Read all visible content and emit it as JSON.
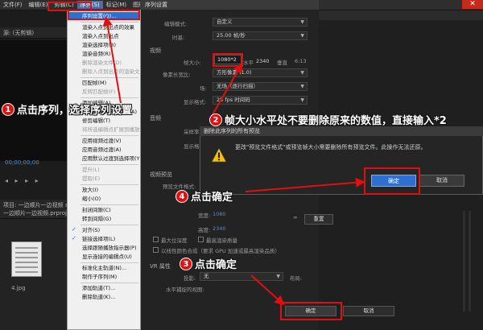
{
  "menubar": {
    "items": [
      "文件(F)",
      "编辑(E)",
      "剪辑(C)",
      "序列(S)",
      "标记(M)",
      "图形(G)",
      "窗口(W)",
      "帮助(H)"
    ],
    "active_index": 3
  },
  "left_panel": {
    "tab_label": "源: (无剪辑)",
    "timecode": "00;00;00;00",
    "project_tabs": "项目: 一边顺片一边视频 ≡",
    "project_tab2": "一边顺片一边视频.prproj",
    "thumb_label": "4.jpg"
  },
  "sequence_menu": {
    "items": [
      {
        "label": "序列设置(Q)...",
        "state": "highlighted"
      },
      {
        "label": "渲染入点到出点的效果",
        "state": "normal"
      },
      {
        "label": "渲染入点到出点",
        "state": "normal"
      },
      {
        "label": "渲染选择项(R)",
        "state": "normal"
      },
      {
        "label": "渲染音频(R)",
        "state": "normal"
      },
      {
        "label": "删除渲染文件(D)",
        "state": "disabled"
      },
      {
        "label": "删除入点到出点的渲染文",
        "state": "disabled"
      },
      {
        "label": "匹配帧(M)",
        "state": "normal"
      },
      {
        "label": "反转匹配帧(F)",
        "state": "disabled"
      },
      {
        "label": "添加编辑(A)",
        "state": "normal"
      },
      {
        "label": "添加编辑到所有轨道(A)",
        "state": "normal"
      },
      {
        "label": "修剪编辑(T)",
        "state": "normal"
      },
      {
        "label": "将所选编辑点扩展到播放",
        "state": "disabled"
      },
      {
        "label": "应用视频过渡(V)",
        "state": "normal"
      },
      {
        "label": "应用音频过渡(A)",
        "state": "normal"
      },
      {
        "label": "应用默认过渡到选择项(Y)",
        "state": "normal"
      },
      {
        "label": "提升(L)",
        "state": "disabled"
      },
      {
        "label": "提取(E)",
        "state": "disabled"
      },
      {
        "label": "放大(I)",
        "state": "normal"
      },
      {
        "label": "缩小(O)",
        "state": "normal"
      },
      {
        "label": "封闭间隙(C)",
        "state": "normal"
      },
      {
        "label": "转到间隔(G)",
        "state": "normal"
      },
      {
        "label": "对齐(S)",
        "state": "checked"
      },
      {
        "label": "链接选择项(L)",
        "state": "checked"
      },
      {
        "label": "选择跟随播放指示器(P)",
        "state": "normal"
      },
      {
        "label": "显示连接的编辑点(U)",
        "state": "normal"
      },
      {
        "label": "标准化主轨道(N)...",
        "state": "normal"
      },
      {
        "label": "制作子序列(M)",
        "state": "normal"
      },
      {
        "label": "添加轨道(T)...",
        "state": "normal"
      },
      {
        "label": "删除轨道(K)...",
        "state": "normal"
      }
    ]
  },
  "sequence_dialog": {
    "title": "序列设置",
    "edit_mode_label": "编辑模式:",
    "edit_mode_value": "自定义",
    "timebase_label": "时基:",
    "timebase_value": "25.00 帧/秒",
    "video_section": "视频",
    "frame_size_label": "帧大小:",
    "frame_w": "1080*2",
    "horizontal_label": "水平",
    "frame_h": "2340",
    "vertical_label": "垂直",
    "aspect_label": "6:13",
    "pixel_aspect_label": "像素长宽比:",
    "pixel_aspect_value": "方形像素 (1.0)",
    "field_label": "场:",
    "field_value": "无场（逐行扫描）",
    "display_format_label": "显示格式:",
    "display_format_value": "25 fps 时间码",
    "audio_section": "音频",
    "sample_rate_label": "采样率:",
    "audio_display_label": "显示格式:",
    "preview_section": "视频预览",
    "preview_format_label": "预览文件格式:",
    "width_label": "宽度:",
    "width_value": "1080",
    "height_label": "高度:",
    "height_value": "2340",
    "reset_label": "重置",
    "max_bit_depth": "最大位深度",
    "max_render_quality": "最高渲染质量",
    "linear_color": "以线性颜色合成（要求 GPU 加速或最高渲染品质）",
    "vr_section": "VR 属性",
    "projection_label": "投影:",
    "projection_value": "无",
    "layout_label": "布局:",
    "horizontal_capture_label": "水平捕捉的视图:",
    "ok_label": "确定",
    "cancel_label": "取消"
  },
  "delete_dialog": {
    "title": "删除此序列的所有预览",
    "message": "更改\"预览文件格式\"或预览帧大小需要删除所有预览文件。此操作无法还原。",
    "ok_label": "确定",
    "cancel_label": "取消"
  },
  "annotations": {
    "step1": "点击序列，选择序列设置",
    "step2": "帧大小水平处不要删除原来的数值，直接输入*2",
    "step3": "点击确定",
    "step4": "点击确定",
    "nums": [
      "1",
      "2",
      "3",
      "4"
    ]
  },
  "colors": {
    "annotation_red": "#e01010",
    "accent_blue": "#2f6fd0",
    "timecode_blue": "#4b8fe0"
  },
  "icons": [
    "warning-icon",
    "close-icon",
    "chain-link-icon",
    "checkmark-icon"
  ]
}
